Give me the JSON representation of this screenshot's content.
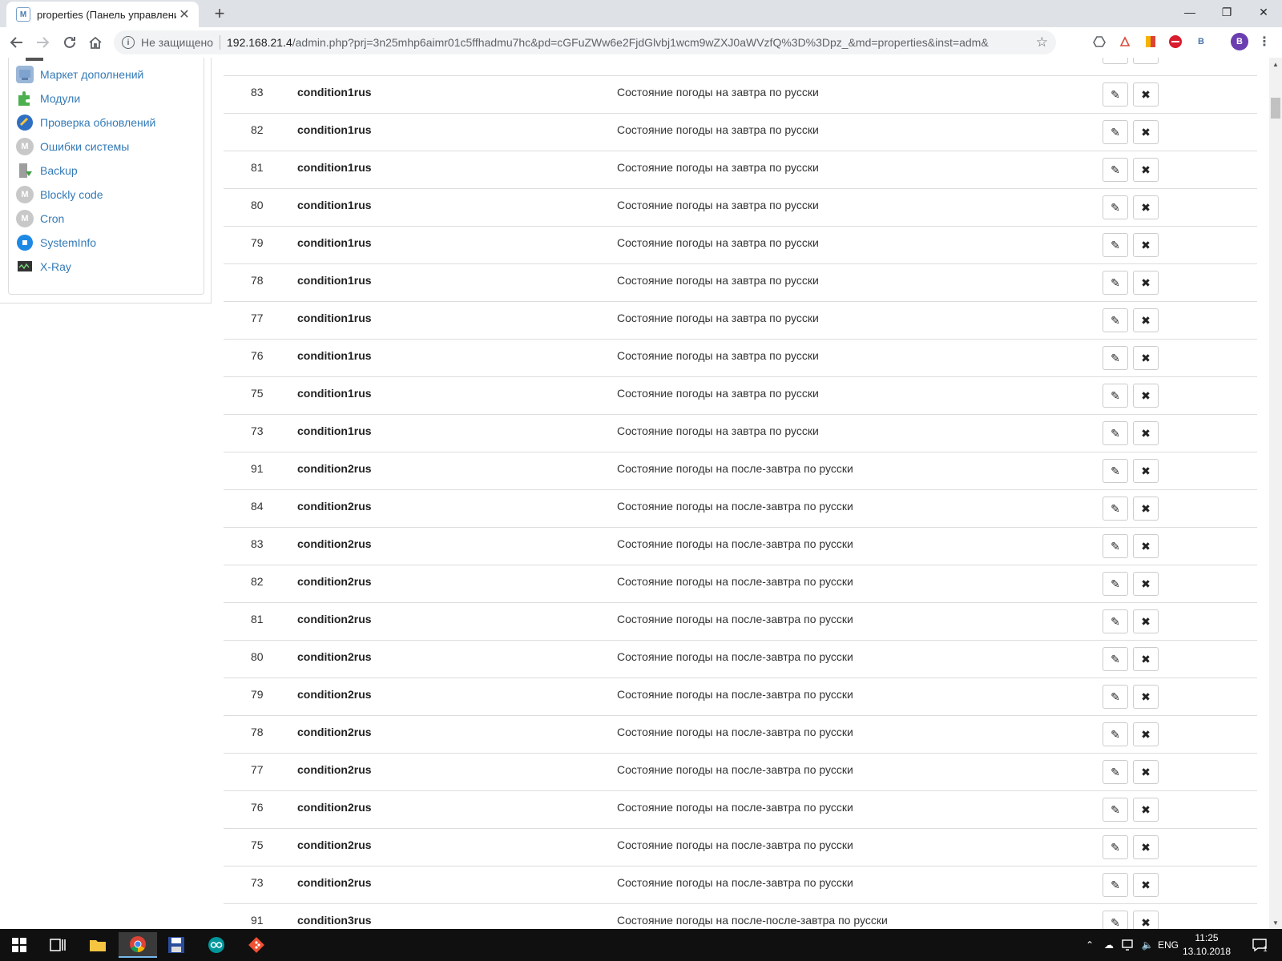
{
  "browser": {
    "tab_title": "properties (Панель управления)",
    "tab_close": "✕",
    "new_tab": "+",
    "favicon": "M",
    "window_controls": {
      "minimize": "—",
      "maximize": "❐",
      "close": "✕"
    },
    "address": {
      "security_label": "Не защищено",
      "host": "192.168.21.4",
      "path": "/admin.php?prj=3n25mhp6aimr01c5ffhadmu7hc&pd=cGFuZWw6e2FjdGlvbj1wcm9wZXJ0aWVzfQ%3D%3Dpz_&md=properties&inst=adm&"
    },
    "profile_initial": "В",
    "extensions": [
      "drive-icon",
      "pdf-icon",
      "bookmark-icon",
      "stop-icon",
      "vk-icon"
    ]
  },
  "sidebar": {
    "items": [
      {
        "label": "Маркет дополнений",
        "icon": "market-icon"
      },
      {
        "label": "Модули",
        "icon": "puzzle-icon"
      },
      {
        "label": "Проверка обновлений",
        "icon": "update-icon"
      },
      {
        "label": "Ошибки системы",
        "icon": "module-icon"
      },
      {
        "label": "Backup",
        "icon": "backup-icon"
      },
      {
        "label": "Blockly code",
        "icon": "module-icon"
      },
      {
        "label": "Cron",
        "icon": "module-icon"
      },
      {
        "label": "SystemInfo",
        "icon": "systeminfo-icon"
      },
      {
        "label": "X-Ray",
        "icon": "xray-icon"
      }
    ]
  },
  "table": {
    "edit_glyph": "✎",
    "delete_glyph": "✖",
    "rows": [
      {
        "id": "83",
        "name": "condition1rus",
        "desc": "Состояние погоды на завтра по русски"
      },
      {
        "id": "82",
        "name": "condition1rus",
        "desc": "Состояние погоды на завтра по русски"
      },
      {
        "id": "81",
        "name": "condition1rus",
        "desc": "Состояние погоды на завтра по русски"
      },
      {
        "id": "80",
        "name": "condition1rus",
        "desc": "Состояние погоды на завтра по русски"
      },
      {
        "id": "79",
        "name": "condition1rus",
        "desc": "Состояние погоды на завтра по русски"
      },
      {
        "id": "78",
        "name": "condition1rus",
        "desc": "Состояние погоды на завтра по русски"
      },
      {
        "id": "77",
        "name": "condition1rus",
        "desc": "Состояние погоды на завтра по русски"
      },
      {
        "id": "76",
        "name": "condition1rus",
        "desc": "Состояние погоды на завтра по русски"
      },
      {
        "id": "75",
        "name": "condition1rus",
        "desc": "Состояние погоды на завтра по русски"
      },
      {
        "id": "73",
        "name": "condition1rus",
        "desc": "Состояние погоды на завтра по русски"
      },
      {
        "id": "91",
        "name": "condition2rus",
        "desc": "Состояние погоды на после-завтра по русски"
      },
      {
        "id": "84",
        "name": "condition2rus",
        "desc": "Состояние погоды на после-завтра по русски"
      },
      {
        "id": "83",
        "name": "condition2rus",
        "desc": "Состояние погоды на после-завтра по русски"
      },
      {
        "id": "82",
        "name": "condition2rus",
        "desc": "Состояние погоды на после-завтра по русски"
      },
      {
        "id": "81",
        "name": "condition2rus",
        "desc": "Состояние погоды на после-завтра по русски"
      },
      {
        "id": "80",
        "name": "condition2rus",
        "desc": "Состояние погоды на после-завтра по русски"
      },
      {
        "id": "79",
        "name": "condition2rus",
        "desc": "Состояние погоды на после-завтра по русски"
      },
      {
        "id": "78",
        "name": "condition2rus",
        "desc": "Состояние погоды на после-завтра по русски"
      },
      {
        "id": "77",
        "name": "condition2rus",
        "desc": "Состояние погоды на после-завтра по русски"
      },
      {
        "id": "76",
        "name": "condition2rus",
        "desc": "Состояние погоды на после-завтра по русски"
      },
      {
        "id": "75",
        "name": "condition2rus",
        "desc": "Состояние погоды на после-завтра по русски"
      },
      {
        "id": "73",
        "name": "condition2rus",
        "desc": "Состояние погоды на после-завтра по русски"
      },
      {
        "id": "91",
        "name": "condition3rus",
        "desc": "Состояние погоды на после-после-завтра по русски"
      }
    ]
  },
  "taskbar": {
    "apps": [
      "windows-start-icon",
      "task-view-icon",
      "file-explorer-icon",
      "chrome-icon",
      "save-app-icon",
      "arduino-icon",
      "git-icon"
    ],
    "language": "ENG",
    "time": "11:25",
    "date": "13.10.2018",
    "notifications": "1"
  },
  "colors": {
    "link": "#337ab7",
    "tabbar": "#dee1e6",
    "taskbar": "#101010"
  }
}
